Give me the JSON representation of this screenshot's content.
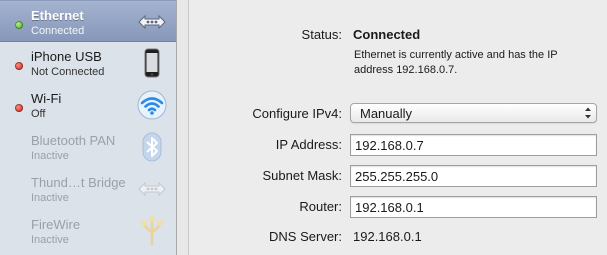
{
  "services": [
    {
      "name": "Ethernet",
      "status": "Connected",
      "indicator": "green",
      "icon": "ethernet-icon",
      "selected": true
    },
    {
      "name": "iPhone USB",
      "status": "Not Connected",
      "indicator": "red",
      "icon": "iphone-icon"
    },
    {
      "name": "Wi-Fi",
      "status": "Off",
      "indicator": "red",
      "icon": "wifi-icon"
    },
    {
      "name": "Bluetooth PAN",
      "status": "Inactive",
      "indicator": "none",
      "icon": "bluetooth-icon"
    },
    {
      "name": "Thund…t Bridge",
      "status": "Inactive",
      "indicator": "none",
      "icon": "thunderbolt-bridge-icon"
    },
    {
      "name": "FireWire",
      "status": "Inactive",
      "indicator": "none",
      "icon": "firewire-icon"
    }
  ],
  "detail": {
    "status_label": "Status:",
    "status_value": "Connected",
    "status_description": "Ethernet is currently active and has the IP address 192.168.0.7.",
    "configure_label": "Configure IPv4:",
    "configure_value": "Manually",
    "ip_label": "IP Address:",
    "ip_value": "192.168.0.7",
    "subnet_label": "Subnet Mask:",
    "subnet_value": "255.255.255.0",
    "router_label": "Router:",
    "router_value": "192.168.0.1",
    "dns_label": "DNS Server:",
    "dns_value": "192.168.0.1"
  },
  "colors": {
    "selected_row": "#8f9fc0",
    "connected": "#3aa31c",
    "disconnected": "#c41a14",
    "wifi_blue": "#2a8be8"
  }
}
